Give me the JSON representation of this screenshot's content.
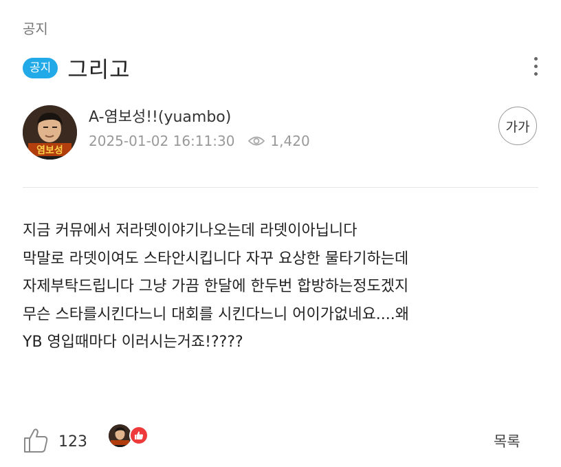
{
  "post": {
    "category": "공지",
    "badge": "공지",
    "title": "그리고",
    "author": "A-염보성!!(yuambo)",
    "date": "2025-01-02 16:11:30",
    "views": "1,420",
    "avatar_caption": "염보성",
    "body_lines": [
      "지금 커뮤에서 저라뎃이야기나오는데 라뎃이아닙니다",
      "막말로 라뎃이여도 스타안시킵니다 자꾸 요상한 물타기하는데",
      "자제부탁드립니다 그냥 가끔 한달에 한두번 합방하는정도겠지",
      "무슨 스타를시킨다느니 대회를 시킨다느니 어이가없네요....왜",
      "YB 영입때마다 이러시는거죠!????"
    ]
  },
  "controls": {
    "font_size_label": "가가",
    "like_count": "123",
    "list_label": "목록"
  },
  "icons": {
    "more": "more-vertical-icon",
    "views": "eye-icon",
    "like": "thumbs-up-icon"
  },
  "colors": {
    "accent": "#22a9e8",
    "reaction": "#ee3a3a"
  }
}
